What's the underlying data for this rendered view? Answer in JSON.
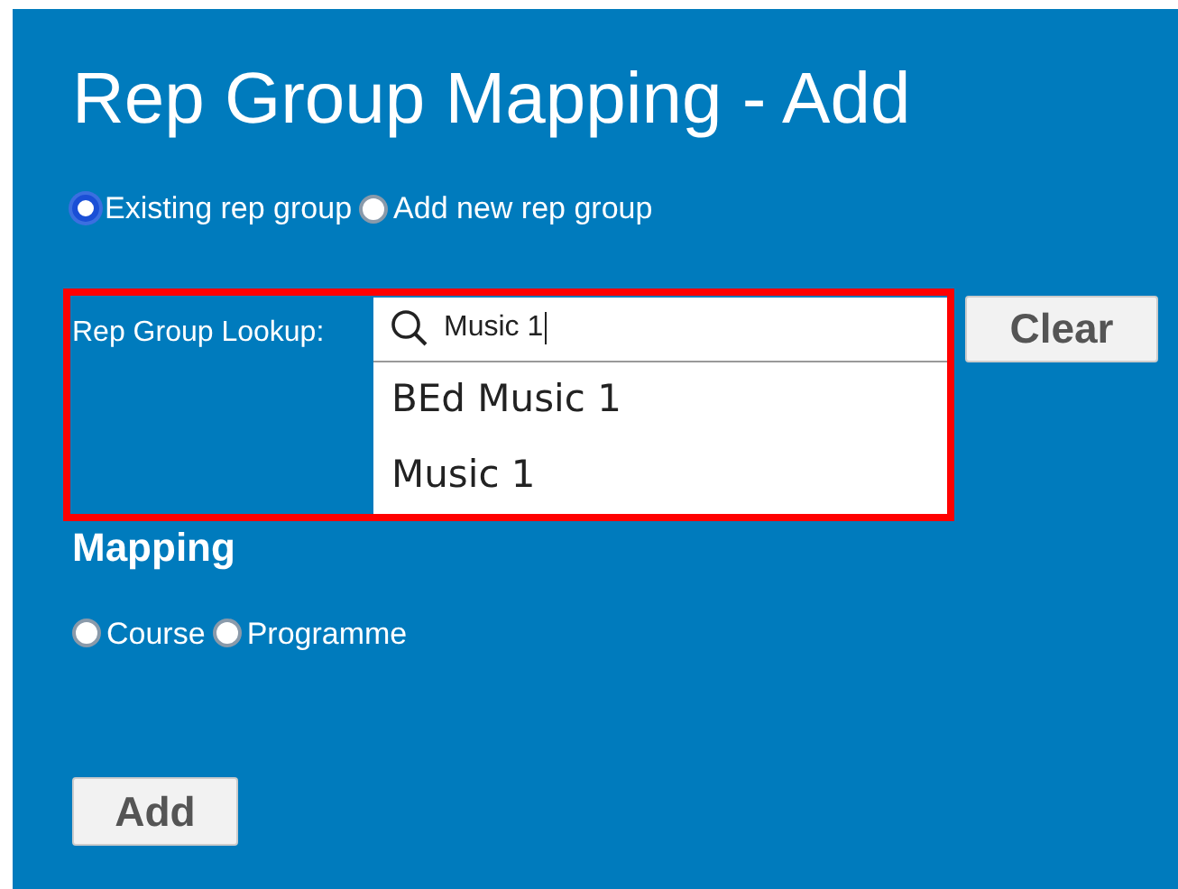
{
  "title": "Rep Group Mapping - Add",
  "group_options": [
    {
      "label": "Existing rep group",
      "selected": true
    },
    {
      "label": "Add new rep group",
      "selected": false
    }
  ],
  "lookup": {
    "label": "Rep Group Lookup:",
    "value": "Music 1",
    "suggestions": [
      "BEd Music 1",
      "Music 1"
    ],
    "clear_button": "Clear"
  },
  "mapping": {
    "heading": "Mapping",
    "options": [
      {
        "label": "Course",
        "selected": false
      },
      {
        "label": "Programme",
        "selected": false
      }
    ]
  },
  "add_button": "Add"
}
